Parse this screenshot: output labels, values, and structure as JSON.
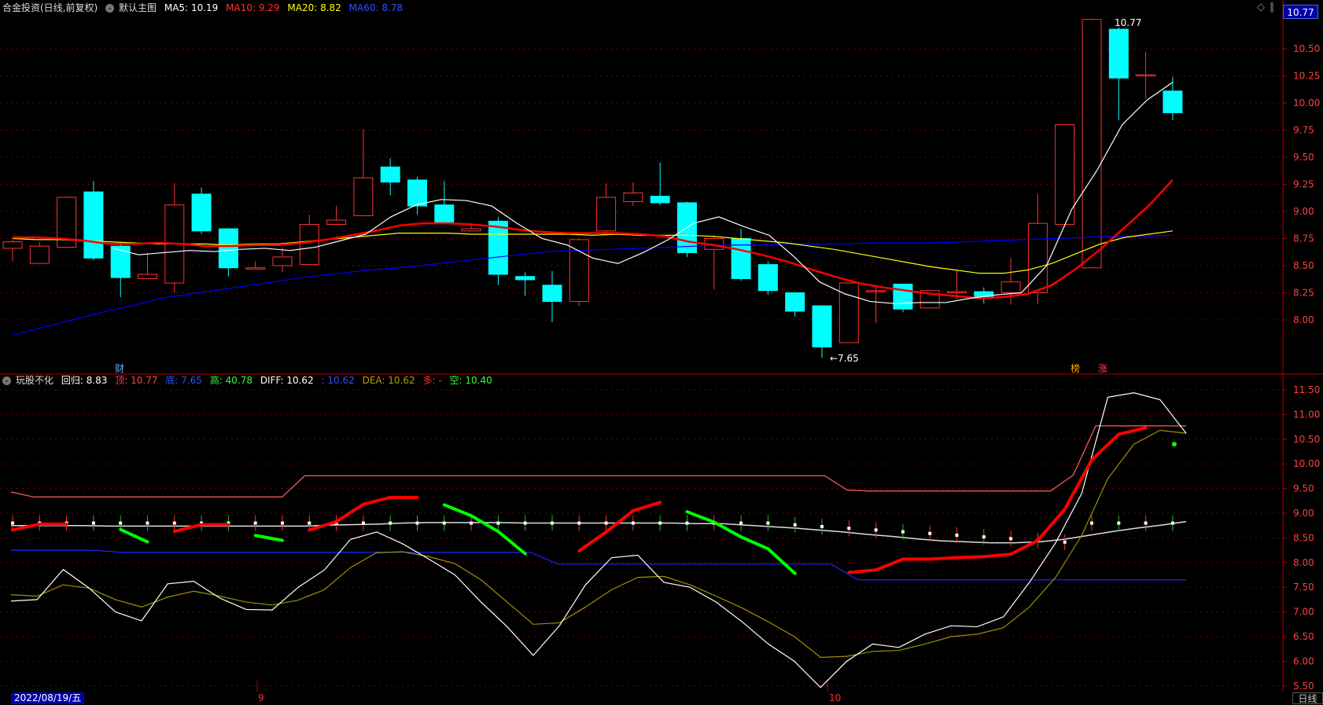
{
  "main_header": {
    "stock": "合金投资(日线,前复权)",
    "chart_label": "默认主图",
    "ma5_label": "MA5:",
    "ma5_value": "10.19",
    "ma10_label": "MA10:",
    "ma10_value": "9.29",
    "ma20_label": "MA20:",
    "ma20_value": "8.82",
    "ma60_label": "MA60:",
    "ma60_value": "8.78"
  },
  "sub_header": {
    "indicator": "玩股不化",
    "huigui_label": "回归:",
    "huigui_value": "8.83",
    "ding_label": "顶:",
    "ding_value": "10.77",
    "di_label": "底:",
    "di_value": "7.65",
    "gao_label": "高:",
    "gao_value": "40.78",
    "diff_label": "DIFF:",
    "diff_value": "10.62",
    "blank_label": ":",
    "blank_value": "10.62",
    "dea_label": "DEA:",
    "dea_value": "10.62",
    "duo_label": "多:",
    "duo_value": "-",
    "kong_label": "空:",
    "kong_value": "10.40"
  },
  "current_price": "10.77",
  "annotations": {
    "high_label": "10.77",
    "low_label": "←7.65",
    "cai": "财",
    "bang": "榜",
    "zhang": "涨"
  },
  "main_axis": [
    "10.50",
    "10.25",
    "10.00",
    "9.75",
    "9.50",
    "9.25",
    "9.00",
    "8.75",
    "8.50",
    "8.25",
    "8.00"
  ],
  "sub_axis": [
    "11.50",
    "11.00",
    "10.50",
    "10.00",
    "9.50",
    "9.00",
    "8.50",
    "8.00",
    "7.50",
    "7.00",
    "6.50",
    "6.00",
    "5.50"
  ],
  "bottom": {
    "date": "2022/08/19/五",
    "month_9": "9",
    "month_10": "10",
    "period": "日线"
  },
  "icons": {
    "diamond": "◇",
    "y_axis_mark": "∥",
    "collapse": "⌄"
  },
  "colors": {
    "up": "#ff3232",
    "down": "#00ffff",
    "ma5": "#ffffff",
    "ma10": "#ff0000",
    "ma20": "#ffff00",
    "ma60": "#0000ff",
    "bull": "#ff0000",
    "bear": "#00ff00",
    "grid": "#7a0000"
  },
  "chart_data": {
    "type": "candlestick",
    "candles": [
      {
        "o": 8.66,
        "h": 8.74,
        "l": 8.54,
        "c": 8.72
      },
      {
        "o": 8.52,
        "h": 8.72,
        "l": 8.52,
        "c": 8.68
      },
      {
        "o": 8.67,
        "h": 9.14,
        "l": 8.67,
        "c": 9.13
      },
      {
        "o": 9.18,
        "h": 9.28,
        "l": 8.55,
        "c": 8.57
      },
      {
        "o": 8.68,
        "h": 8.72,
        "l": 8.21,
        "c": 8.39
      },
      {
        "o": 8.38,
        "h": 8.62,
        "l": 8.38,
        "c": 8.42
      },
      {
        "o": 8.34,
        "h": 9.26,
        "l": 8.25,
        "c": 9.06
      },
      {
        "o": 9.16,
        "h": 9.22,
        "l": 8.79,
        "c": 8.82
      },
      {
        "o": 8.84,
        "h": 8.84,
        "l": 8.4,
        "c": 8.48
      },
      {
        "o": 8.48,
        "h": 8.54,
        "l": 8.48,
        "c": 8.48
      },
      {
        "o": 8.5,
        "h": 8.67,
        "l": 8.44,
        "c": 8.58
      },
      {
        "o": 8.51,
        "h": 8.97,
        "l": 8.51,
        "c": 8.88
      },
      {
        "o": 8.88,
        "h": 9.05,
        "l": 8.88,
        "c": 8.92
      },
      {
        "o": 8.96,
        "h": 9.76,
        "l": 8.96,
        "c": 9.31
      },
      {
        "o": 9.41,
        "h": 9.49,
        "l": 9.15,
        "c": 9.27
      },
      {
        "o": 9.29,
        "h": 9.32,
        "l": 8.97,
        "c": 9.05
      },
      {
        "o": 9.06,
        "h": 9.28,
        "l": 8.92,
        "c": 8.9
      },
      {
        "o": 8.82,
        "h": 8.89,
        "l": 8.82,
        "c": 8.84
      },
      {
        "o": 8.91,
        "h": 8.95,
        "l": 8.32,
        "c": 8.42
      },
      {
        "o": 8.4,
        "h": 8.44,
        "l": 8.22,
        "c": 8.37
      },
      {
        "o": 8.32,
        "h": 8.45,
        "l": 7.98,
        "c": 8.17
      },
      {
        "o": 8.17,
        "h": 8.75,
        "l": 8.13,
        "c": 8.74
      },
      {
        "o": 8.82,
        "h": 9.26,
        "l": 8.8,
        "c": 9.13
      },
      {
        "o": 9.09,
        "h": 9.27,
        "l": 9.05,
        "c": 9.17
      },
      {
        "o": 9.14,
        "h": 9.45,
        "l": 9.06,
        "c": 9.08
      },
      {
        "o": 9.08,
        "h": 9.09,
        "l": 8.58,
        "c": 8.62
      },
      {
        "o": 8.65,
        "h": 8.78,
        "l": 8.28,
        "c": 8.75
      },
      {
        "o": 8.75,
        "h": 8.84,
        "l": 8.36,
        "c": 8.38
      },
      {
        "o": 8.51,
        "h": 8.54,
        "l": 8.23,
        "c": 8.27
      },
      {
        "o": 8.25,
        "h": 8.25,
        "l": 8.03,
        "c": 8.08
      },
      {
        "o": 8.13,
        "h": 8.13,
        "l": 7.65,
        "c": 7.75
      },
      {
        "o": 7.79,
        "h": 8.34,
        "l": 7.79,
        "c": 8.34
      },
      {
        "o": 8.26,
        "h": 8.3,
        "l": 7.97,
        "c": 8.27
      },
      {
        "o": 8.33,
        "h": 8.33,
        "l": 8.07,
        "c": 8.1
      },
      {
        "o": 8.11,
        "h": 8.27,
        "l": 8.11,
        "c": 8.27
      },
      {
        "o": 8.26,
        "h": 8.46,
        "l": 8.19,
        "c": 8.26
      },
      {
        "o": 8.26,
        "h": 8.3,
        "l": 8.15,
        "c": 8.2
      },
      {
        "o": 8.25,
        "h": 8.57,
        "l": 8.14,
        "c": 8.35
      },
      {
        "o": 8.25,
        "h": 9.16,
        "l": 8.15,
        "c": 8.89
      },
      {
        "o": 8.88,
        "h": 9.8,
        "l": 8.86,
        "c": 9.8
      },
      {
        "o": 8.48,
        "h": 10.78,
        "l": 9.84,
        "c": 10.77
      },
      {
        "o": 10.68,
        "h": 10.7,
        "l": 9.84,
        "c": 10.23
      },
      {
        "o": 10.26,
        "h": 10.47,
        "l": 10.04,
        "c": 10.26
      },
      {
        "o": 10.11,
        "h": 10.24,
        "l": 9.84,
        "c": 9.91
      }
    ],
    "ma5": [
      null,
      null,
      null,
      null,
      8.66,
      8.6,
      8.62,
      8.64,
      8.63,
      8.65,
      8.66,
      8.64,
      8.67,
      8.73,
      8.79,
      8.95,
      9.06,
      9.11,
      9.1,
      9.05,
      8.89,
      8.75,
      8.69,
      8.57,
      8.52,
      8.62,
      8.74,
      8.89,
      8.95,
      8.86,
      8.78,
      8.58,
      8.35,
      8.24,
      8.17,
      8.15,
      8.16,
      8.16,
      8.2,
      8.23,
      8.25,
      8.5,
      9.02,
      9.38,
      9.8,
      10.03,
      10.19
    ],
    "ma10": [
      8.76,
      8.76,
      8.75,
      8.73,
      8.7,
      8.7,
      8.71,
      8.7,
      8.68,
      8.68,
      8.69,
      8.69,
      8.71,
      8.74,
      8.78,
      8.82,
      8.87,
      8.89,
      8.89,
      8.88,
      8.86,
      8.83,
      8.81,
      8.8,
      8.8,
      8.8,
      8.79,
      8.77,
      8.72,
      8.69,
      8.65,
      8.6,
      8.54,
      8.47,
      8.4,
      8.34,
      8.3,
      8.27,
      8.24,
      8.22,
      8.2,
      8.21,
      8.24,
      8.32,
      8.47,
      8.65,
      8.85,
      9.05,
      9.29
    ],
    "ma20": [
      8.75,
      8.74,
      8.74,
      8.73,
      8.72,
      8.71,
      8.7,
      8.7,
      8.7,
      8.69,
      8.7,
      8.7,
      8.72,
      8.74,
      8.76,
      8.78,
      8.8,
      8.8,
      8.8,
      8.79,
      8.79,
      8.79,
      8.79,
      8.79,
      8.78,
      8.79,
      8.78,
      8.78,
      8.78,
      8.77,
      8.75,
      8.73,
      8.71,
      8.68,
      8.65,
      8.61,
      8.57,
      8.53,
      8.49,
      8.46,
      8.43,
      8.43,
      8.46,
      8.52,
      8.61,
      8.7,
      8.76,
      8.79,
      8.82
    ],
    "ma60": [
      7.86,
      7.93,
      8.0,
      8.07,
      8.13,
      8.2,
      8.24,
      8.28,
      8.32,
      8.36,
      8.4,
      8.43,
      8.46,
      8.48,
      8.51,
      8.54,
      8.57,
      8.6,
      8.63,
      8.64,
      8.65,
      8.66,
      8.67,
      8.68,
      8.69,
      8.69,
      8.7,
      8.7,
      8.7,
      8.71,
      8.71,
      8.71,
      8.72,
      8.73,
      8.74,
      8.75,
      8.76,
      8.77,
      8.77,
      8.78
    ],
    "indicator": {
      "ding_line": [
        9.43,
        9.33,
        9.33,
        9.33,
        9.33,
        9.33,
        9.33,
        9.33,
        9.33,
        9.33,
        9.33,
        9.33,
        9.33,
        9.76,
        9.76,
        9.76,
        9.76,
        9.76,
        9.76,
        9.76,
        9.76,
        9.76,
        9.76,
        9.76,
        9.76,
        9.76,
        9.76,
        9.76,
        9.76,
        9.76,
        9.76,
        9.76,
        9.76,
        9.76,
        9.76,
        9.76,
        9.76,
        9.47,
        9.45,
        9.45,
        9.45,
        9.45,
        9.45,
        9.45,
        9.45,
        9.45,
        9.45,
        9.77,
        10.77,
        10.77,
        10.77,
        10.77,
        10.77
      ],
      "di_line": [
        8.25,
        8.25,
        8.25,
        8.25,
        8.21,
        8.21,
        8.21,
        8.21,
        8.21,
        8.21,
        8.21,
        8.21,
        8.21,
        8.21,
        8.21,
        8.21,
        8.21,
        8.21,
        8.21,
        8.21,
        7.97,
        7.97,
        7.97,
        7.97,
        7.97,
        7.97,
        7.97,
        7.97,
        7.97,
        7.97,
        7.97,
        7.65,
        7.65,
        7.65,
        7.65,
        7.65,
        7.65,
        7.65,
        7.65,
        7.65,
        7.65,
        7.65,
        7.65,
        7.65
      ],
      "huigui_line": [
        8.75,
        8.75,
        8.75,
        8.75,
        8.74,
        8.74,
        8.74,
        8.74,
        8.74,
        8.74,
        8.74,
        8.74,
        8.74,
        8.76,
        8.77,
        8.78,
        8.8,
        8.81,
        8.81,
        8.81,
        8.81,
        8.8,
        8.8,
        8.8,
        8.8,
        8.8,
        8.8,
        8.8,
        8.79,
        8.79,
        8.76,
        8.73,
        8.7,
        8.66,
        8.62,
        8.57,
        8.53,
        8.48,
        8.44,
        8.42,
        8.4,
        8.4,
        8.42,
        8.47,
        8.55,
        8.63,
        8.7,
        8.76,
        8.83
      ],
      "diff_line": [
        7.22,
        7.25,
        7.86,
        7.48,
        7.0,
        6.82,
        7.57,
        7.62,
        7.28,
        7.05,
        7.04,
        7.5,
        7.85,
        8.47,
        8.62,
        8.38,
        8.07,
        7.75,
        7.2,
        6.7,
        6.12,
        6.72,
        7.55,
        8.1,
        8.15,
        7.6,
        7.5,
        7.2,
        6.8,
        6.35,
        6.0,
        5.47,
        6.0,
        6.35,
        6.28,
        6.55,
        6.72,
        6.7,
        6.9,
        7.6,
        8.4,
        9.4,
        11.35,
        11.44,
        11.3,
        10.62
      ],
      "dea_line": [
        7.35,
        7.32,
        7.55,
        7.48,
        7.25,
        7.1,
        7.3,
        7.42,
        7.32,
        7.2,
        7.14,
        7.24,
        7.45,
        7.9,
        8.2,
        8.22,
        8.12,
        7.98,
        7.65,
        7.2,
        6.75,
        6.78,
        7.1,
        7.45,
        7.7,
        7.72,
        7.55,
        7.32,
        7.08,
        6.8,
        6.5,
        6.08,
        6.1,
        6.2,
        6.22,
        6.35,
        6.5,
        6.55,
        6.68,
        7.1,
        7.7,
        8.55,
        9.7,
        10.4,
        10.68,
        10.62
      ],
      "bull_segments": [
        [
          [
            0,
            8.66
          ],
          [
            1,
            8.78
          ],
          [
            2,
            8.78
          ]
        ],
        [
          [
            6,
            8.63
          ],
          [
            7,
            8.77
          ],
          [
            8,
            8.77
          ]
        ],
        [
          [
            11,
            8.66
          ],
          [
            12,
            8.83
          ],
          [
            13,
            9.18
          ],
          [
            14,
            9.32
          ],
          [
            15,
            9.32
          ]
        ],
        [
          [
            21,
            8.24
          ],
          [
            22,
            8.62
          ],
          [
            23,
            9.05
          ],
          [
            24,
            9.22
          ]
        ],
        [
          [
            31,
            7.8
          ],
          [
            32,
            7.85
          ],
          [
            33,
            8.07
          ],
          [
            34,
            8.07
          ],
          [
            35,
            8.1
          ],
          [
            36,
            8.12
          ],
          [
            37,
            8.17
          ],
          [
            38,
            8.45
          ],
          [
            39,
            9.08
          ],
          [
            40,
            10.08
          ],
          [
            41,
            10.6
          ],
          [
            42,
            10.73
          ]
        ]
      ],
      "bear_segments": [
        [
          [
            4,
            8.67
          ],
          [
            5,
            8.42
          ]
        ],
        [
          [
            9,
            8.55
          ],
          [
            10,
            8.45
          ]
        ],
        [
          [
            16,
            9.17
          ],
          [
            17,
            8.95
          ],
          [
            18,
            8.63
          ],
          [
            19,
            8.18
          ]
        ],
        [
          [
            25,
            9.03
          ],
          [
            26,
            8.82
          ],
          [
            27,
            8.52
          ],
          [
            28,
            8.28
          ],
          [
            29,
            7.78
          ]
        ]
      ]
    }
  }
}
